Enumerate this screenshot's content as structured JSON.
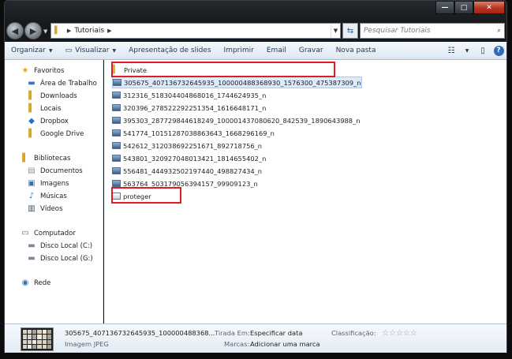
{
  "window": {
    "controls": {
      "minimize": "—",
      "maximize": "□",
      "close": "✕"
    }
  },
  "address_bar": {
    "path": [
      "Tutoriais"
    ],
    "search_placeholder": "Pesquisar Tutoriais"
  },
  "toolbar": {
    "organize": "Organizar",
    "view": "Visualizar",
    "slideshow": "Apresentação de slides",
    "print": "Imprimir",
    "email": "Email",
    "burn": "Gravar",
    "new_folder": "Nova pasta"
  },
  "nav_pane": {
    "favorites": {
      "label": "Favoritos",
      "items": [
        "Área de Trabalho",
        "Downloads",
        "Locais",
        "Dropbox",
        "Google Drive"
      ]
    },
    "libraries": {
      "label": "Bibliotecas",
      "items": [
        "Documentos",
        "Imagens",
        "Músicas",
        "Vídeos"
      ]
    },
    "computer": {
      "label": "Computador",
      "items": [
        "Disco Local (C:)",
        "Disco Local (G:)"
      ]
    },
    "network": {
      "label": "Rede"
    }
  },
  "files": [
    {
      "name": "Private",
      "type": "folder"
    },
    {
      "name": "305675_407136732645935_100000488368930_1576300_475387309_n",
      "type": "image",
      "selected": true
    },
    {
      "name": "312316_518304404868016_1744624935_n",
      "type": "image"
    },
    {
      "name": "320396_278522292251354_1616648171_n",
      "type": "image"
    },
    {
      "name": "395303_287729844618249_100001437080620_842539_1890643988_n",
      "type": "image"
    },
    {
      "name": "541774_10151287038863643_1668296169_n",
      "type": "image"
    },
    {
      "name": "542612_312038692251671_892718756_n",
      "type": "image"
    },
    {
      "name": "543801_320927048013421_1814655402_n",
      "type": "image"
    },
    {
      "name": "556481_444932502197440_498827434_n",
      "type": "image"
    },
    {
      "name": "563764_503179056394157_99909123_n",
      "type": "image"
    },
    {
      "name": "proteger",
      "type": "file"
    }
  ],
  "details": {
    "filename": "305675_407136732645935_100000488368...",
    "filetype": "Imagem JPEG",
    "date_taken_label": "Tirada Em:",
    "date_taken_value": "Especificar data",
    "tags_label": "Marcas:",
    "tags_value": "Adicionar uma marca",
    "rating_label": "Classificação:",
    "rating": 0
  },
  "colors": {
    "highlight": "#e11b23",
    "selection": "#dcebfb"
  }
}
